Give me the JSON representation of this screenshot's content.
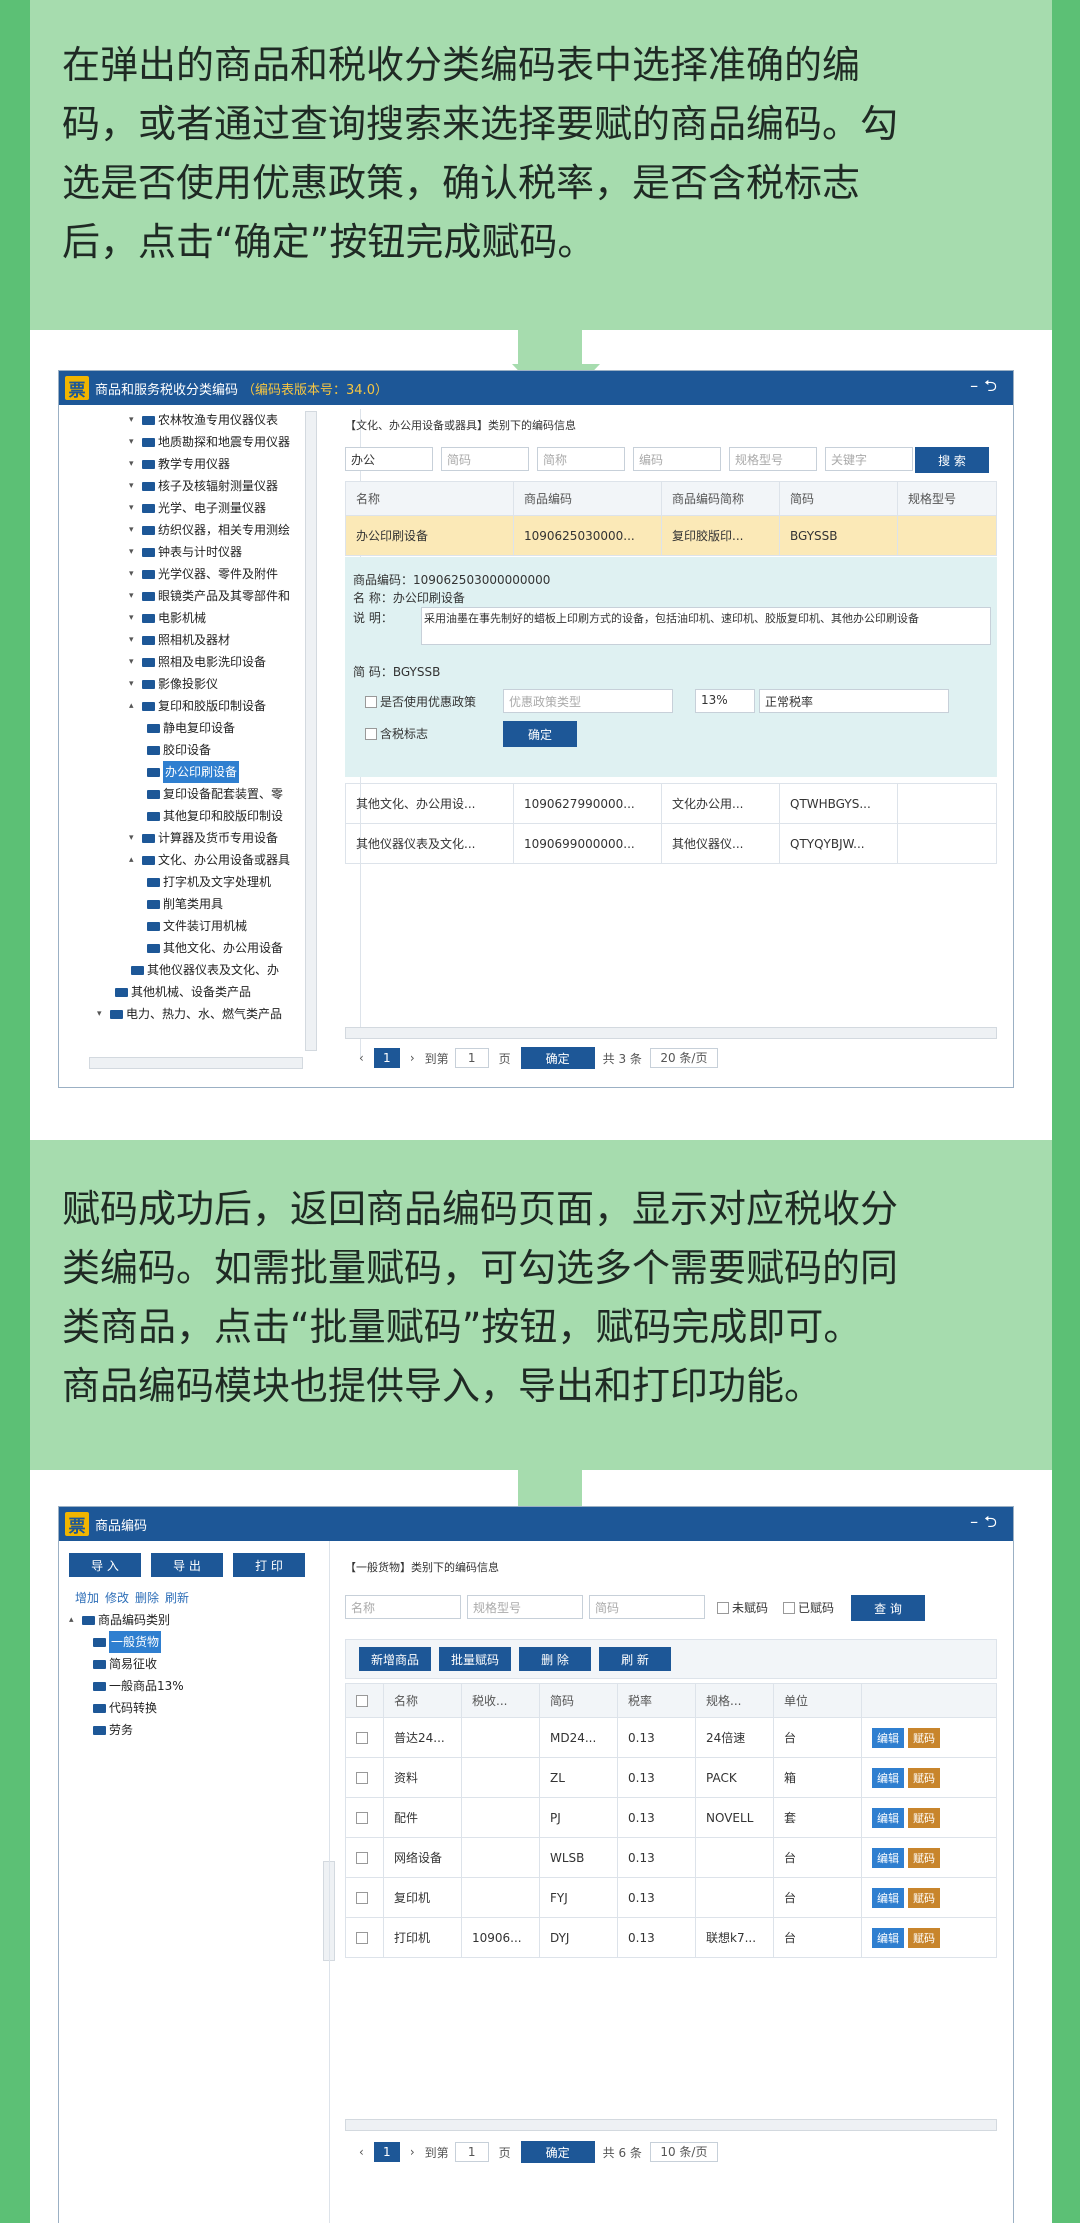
{
  "instruction1": [
    "在弹出的商品和税收分类编码表中选择准确的编",
    "码，或者通过查询搜索来选择要赋的商品编码。勾",
    "选是否使用优惠政策，确认税率，是否含税标志",
    "后，点击“确定”按钮完成赋码。"
  ],
  "instruction2": [
    "赋码成功后，返回商品编码页面，显示对应税收分",
    "类编码。如需批量赋码，可勾选多个需要赋码的同",
    "类商品，点击“批量赋码”按钮，赋码完成即可。",
    "商品编码模块也提供导入，导出和打印功能。"
  ],
  "w1": {
    "logo": "票",
    "title": "商品和服务税收分类编码",
    "version": "（编码表版本号：34.0）",
    "controls": "–⮌",
    "tree": [
      "农林牧渔专用仪器仪表",
      "地质勘探和地震专用仪器",
      "教学专用仪器",
      "核子及核辐射测量仪器",
      "光学、电子测量仪器",
      "纺织仪器，相关专用测绘",
      "钟表与计时仪器",
      "光学仪器、零件及附件",
      "眼镜类产品及其零部件和",
      "电影机械",
      "照相机及器材",
      "照相及电影洗印设备",
      "影像投影仪",
      "复印和胶版印制设备",
      "静电复印设备",
      "胶印设备",
      "办公印刷设备",
      "复印设备配套装置、零",
      "其他复印和胶版印制设",
      "计算器及货币专用设备",
      "文化、办公用设备或器具",
      "打字机及文字处理机",
      "削笔类用具",
      "文件装订用机械",
      "其他文化、办公用设备",
      "其他仪器仪表及文化、办",
      "其他机械、设备类产品",
      "电力、热力、水、燃气类产品"
    ],
    "category": "【文化、办公用设备或器具】类别下的编码信息",
    "search": {
      "keyword": "办公",
      "ph1": "简码",
      "ph2": "简称",
      "ph3": "编码",
      "ph4": "规格型号",
      "ph5": "关键字",
      "btn": "搜 索"
    },
    "headers": [
      "名称",
      "商品编码",
      "商品编码简称",
      "简码",
      "规格型号"
    ],
    "rows": [
      [
        "办公印刷设备",
        "1090625030000...",
        "复印胶版印...",
        "BGYSSB",
        ""
      ],
      [
        "其他文化、办公用设...",
        "1090627990000...",
        "文化办公用...",
        "QTWHBGYS...",
        ""
      ],
      [
        "其他仪器仪表及文化...",
        "1090699000000...",
        "其他仪器仪...",
        "QTYQYBJW...",
        ""
      ]
    ],
    "detail": {
      "code": "商品编码：109062503000000000",
      "name": "名    称：办公印刷设备",
      "desc_label": "说    明：",
      "desc": "采用油墨在事先制好的蜡板上印刷方式的设备，包括油印机、速印机、胶版复印机、其他办公印刷设备",
      "jm": "简    码：BGYSSB",
      "pref_label": "是否使用优惠政策",
      "pref_ph": "优惠政策类型",
      "rate": "13%",
      "rate_type": "正常税率",
      "tax_label": "含税标志",
      "ok": "确定"
    },
    "pager": {
      "page": "1",
      "goto": "到第",
      "input": "1",
      "unit": "页",
      "ok": "确定",
      "total": "共 3 条",
      "per": "20 条/页"
    }
  },
  "w2": {
    "logo": "票",
    "title": "商品编码",
    "controls": "–⮌",
    "btns": [
      "导 入",
      "导 出",
      "打 印"
    ],
    "links": [
      "增加",
      "修改",
      "删除",
      "刷新"
    ],
    "tree_root": "商品编码类别",
    "tree": [
      "一般货物",
      "简易征收",
      "一般商品13%",
      "代码转换",
      "劳务"
    ],
    "category": "【一般货物】类别下的编码信息",
    "search": {
      "ph1": "名称",
      "ph2": "规格型号",
      "ph3": "简码",
      "chk1": "未赋码",
      "chk2": "已赋码",
      "btn": "查 询"
    },
    "actions": [
      "新增商品",
      "批量赋码",
      "删 除",
      "刷 新"
    ],
    "headers": [
      "名称",
      "税收...",
      "简码",
      "税率",
      "规格...",
      "单位"
    ],
    "rows": [
      [
        "普达24...",
        "",
        "MD24...",
        "0.13",
        "24倍速",
        "台"
      ],
      [
        "资料",
        "",
        "ZL",
        "0.13",
        "PACK",
        "箱"
      ],
      [
        "配件",
        "",
        "PJ",
        "0.13",
        "NOVELL",
        "套"
      ],
      [
        "网络设备",
        "",
        "WLSB",
        "0.13",
        "",
        "台"
      ],
      [
        "复印机",
        "",
        "FYJ",
        "0.13",
        "",
        "台"
      ],
      [
        "打印机",
        "10906...",
        "DYJ",
        "0.13",
        "联想k7...",
        "台"
      ]
    ],
    "edit": "编辑",
    "assign": "赋码",
    "pager": {
      "page": "1",
      "goto": "到第",
      "input": "1",
      "unit": "页",
      "ok": "确定",
      "total": "共 6 条",
      "per": "10 条/页"
    }
  }
}
